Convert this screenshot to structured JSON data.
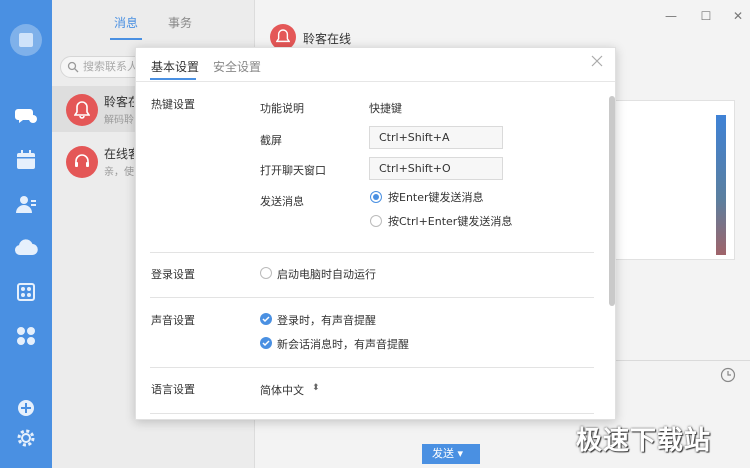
{
  "sidebar": {
    "items": [
      {
        "icon": "chat-bubble-icon"
      },
      {
        "icon": "calendar-icon"
      },
      {
        "icon": "contacts-icon"
      },
      {
        "icon": "cloud-icon"
      },
      {
        "icon": "apps-icon"
      },
      {
        "icon": "grid-icon"
      },
      {
        "icon": "add-icon"
      },
      {
        "icon": "gear-icon"
      }
    ]
  },
  "conv_list": {
    "tabs": [
      "消息",
      "事务"
    ],
    "search_placeholder": "搜索联系人、",
    "items": [
      {
        "name": "聆客在线",
        "preview": "解码聆客"
      },
      {
        "name": "在线客服",
        "preview": "亲，使用"
      }
    ]
  },
  "main": {
    "header_title": "聆客在线",
    "send_label": "发送",
    "window_controls": [
      "—",
      "☐",
      "✕"
    ]
  },
  "watermark": "极速下载站",
  "settings": {
    "tabs": [
      "基本设置",
      "安全设置"
    ],
    "hotkey": {
      "section": "热键设置",
      "col_func": "功能说明",
      "col_key": "快捷键",
      "rows": [
        {
          "label": "截屏",
          "value": "Ctrl+Shift+A"
        },
        {
          "label": "打开聊天窗口",
          "value": "Ctrl+Shift+O"
        }
      ],
      "send_label": "发送消息",
      "send_options": [
        "按Enter键发送消息",
        "按Ctrl+Enter键发送消息"
      ]
    },
    "login": {
      "section": "登录设置",
      "option": "启动电脑时自动运行"
    },
    "sound": {
      "section": "声音设置",
      "options": [
        "登录时，有声音提醒",
        "新会话消息时，有声音提醒"
      ]
    },
    "language": {
      "section": "语言设置",
      "value": "简体中文"
    }
  }
}
